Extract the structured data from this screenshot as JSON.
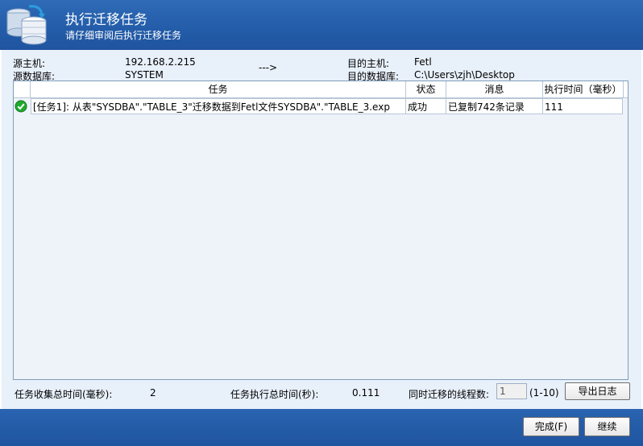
{
  "header": {
    "title": "执行迁移任务",
    "subtitle": "请仔细审阅后执行迁移任务"
  },
  "connection": {
    "source_host_label": "源主机:",
    "source_host": "192.168.2.215",
    "source_db_label": "源数据库:",
    "source_db": "SYSTEM",
    "arrow": "--->",
    "dest_host_label": "目的主机:",
    "dest_host": "Fetl",
    "dest_db_label": "目的数据库:",
    "dest_db": "C:\\Users\\zjh\\Desktop"
  },
  "table": {
    "columns": [
      "任务",
      "状态",
      "消息",
      "执行时间（毫秒）"
    ],
    "rows": [
      {
        "task": "[任务1]: 从表\"SYSDBA\".\"TABLE_3\"迁移数据到Fetl文件SYSDBA\".\"TABLE_3.exp",
        "status": "成功",
        "message": "已复制742条记录",
        "time": "111",
        "icon": "success-check-icon"
      }
    ]
  },
  "summary": {
    "collect_time_label": "任务收集总时间(毫秒):",
    "collect_time": "2",
    "exec_time_label": "任务执行总时间(秒):",
    "exec_time": "0.111",
    "threads_label": "同时迁移的线程数:",
    "threads_value": "1",
    "threads_range": "(1-10)",
    "export_log_label": "导出日志"
  },
  "footer": {
    "finish_label": "完成(F)",
    "continue_label": "继续"
  },
  "colors": {
    "header_blue": "#235ca8",
    "content_bg": "#e8f0fa",
    "success_green": "#1faa2e"
  }
}
